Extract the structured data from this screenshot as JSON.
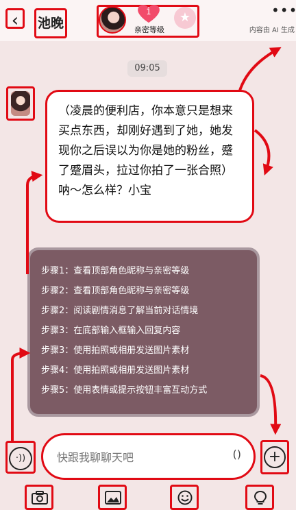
{
  "header": {
    "back_icon": "back-arrow-icon",
    "name": "池晚",
    "intimacy": {
      "level": "1",
      "label": "亲密等级",
      "heart_color": "#f24b6a"
    },
    "ai_note": "内容由 AI 生成",
    "more_icon": "more-icon"
  },
  "chat": {
    "time": "09:05",
    "message": "（凌晨的便利店，你本意只是想来买点东西，却刚好遇到了她，她发现你之后误以为你是她的粉丝，蹙了蹙眉头，拉过你拍了一张合照）呐～怎么样？小宝"
  },
  "steps": [
    "步骤1：查看顶部角色昵称与亲密等级",
    "步骤2：查看顶部角色昵称与亲密等级",
    "步骤2：阅读剧情消息了解当前对话情境",
    "步骤3：在底部输入框输入回复内容",
    "步骤3：使用拍照或相册发送图片素材",
    "步骤4：使用拍照或相册发送图片素材",
    "步骤5：使用表情或提示按钮丰富互动方式"
  ],
  "input": {
    "placeholder": "快跟我聊聊天吧",
    "paren": "()"
  },
  "toolbar": {
    "camera_icon": "camera-icon",
    "image_icon": "image-icon",
    "emoji_icon": "emoji-icon",
    "bulb_icon": "lightbulb-icon"
  },
  "colors": {
    "accent": "#e10a14",
    "background": "#f3e6e6",
    "steps_bg": "#7c5b64"
  }
}
